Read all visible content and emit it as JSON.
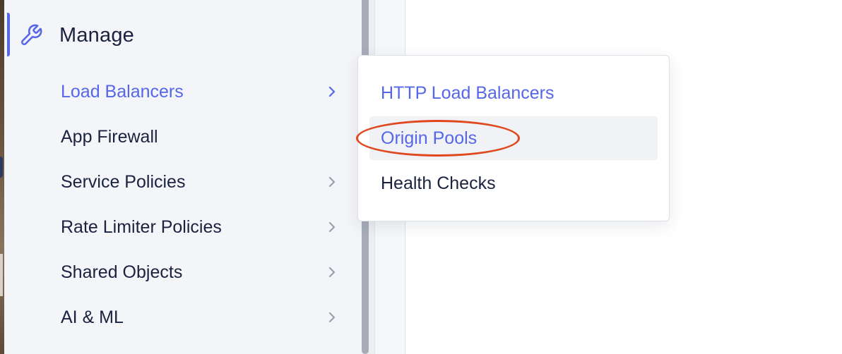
{
  "sidebar": {
    "section_title": "Manage",
    "section_icon": "wrench-icon",
    "items": [
      {
        "label": "Load Balancers",
        "has_submenu": true,
        "active": true
      },
      {
        "label": "App Firewall",
        "has_submenu": false,
        "active": false
      },
      {
        "label": "Service Policies",
        "has_submenu": true,
        "active": false
      },
      {
        "label": "Rate Limiter Policies",
        "has_submenu": true,
        "active": false
      },
      {
        "label": "Shared Objects",
        "has_submenu": true,
        "active": false
      },
      {
        "label": "AI & ML",
        "has_submenu": true,
        "active": false
      }
    ]
  },
  "flyout": {
    "items": [
      {
        "label": "HTTP Load Balancers",
        "style": "link"
      },
      {
        "label": "Origin Pools",
        "style": "link",
        "hovered": true,
        "annotated": true
      },
      {
        "label": "Health Checks",
        "style": "default"
      }
    ]
  },
  "colors": {
    "accent": "#5567e8",
    "text": "#1b2240",
    "annotation": "#e0491e",
    "sidebar_bg": "#f4f5f8"
  }
}
